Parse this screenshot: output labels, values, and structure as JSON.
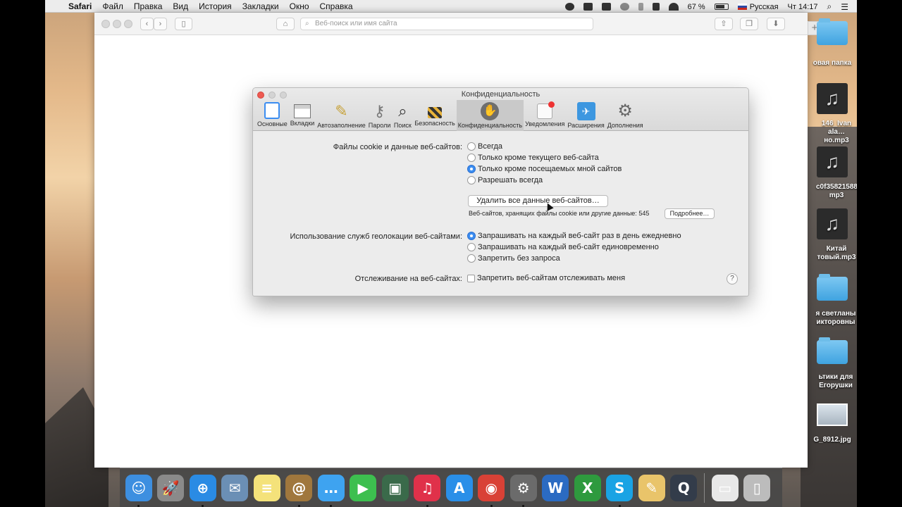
{
  "menubar": {
    "apple": "",
    "app": "Safari",
    "items": [
      "Файл",
      "Правка",
      "Вид",
      "История",
      "Закладки",
      "Окно",
      "Справка"
    ],
    "battery": "67 %",
    "input_source": "Русская",
    "clock": "Чт 14:17"
  },
  "safari": {
    "url_placeholder": "Веб-поиск или имя сайта",
    "new_tab": "+"
  },
  "prefs": {
    "title": "Конфиденциальность",
    "tabs": [
      {
        "label": "Основные",
        "icon": "switch-icon"
      },
      {
        "label": "Вкладки",
        "icon": "tabs-icon"
      },
      {
        "label": "Автозаполнение",
        "icon": "pencil-icon"
      },
      {
        "label": "Пароли",
        "icon": "key-icon"
      },
      {
        "label": "Поиск",
        "icon": "magnifier-icon"
      },
      {
        "label": "Безопасность",
        "icon": "lock-icon"
      },
      {
        "label": "Конфиденциальность",
        "icon": "hand-icon",
        "active": true
      },
      {
        "label": "Уведомления",
        "icon": "notification-icon"
      },
      {
        "label": "Расширения",
        "icon": "puzzle-icon"
      },
      {
        "label": "Дополнения",
        "icon": "gear-icon"
      }
    ],
    "cookies": {
      "label": "Файлы cookie и данные веб-сайтов:",
      "options": [
        "Всегда",
        "Только кроме текущего веб-сайта",
        "Только кроме посещаемых мной сайтов",
        "Разрешать всегда"
      ],
      "selected": 2,
      "remove_button": "Удалить все данные веб-сайтов…",
      "info": "Веб-сайтов, хранящих файлы cookie или другие данные: 545",
      "details_button": "Подробнее…"
    },
    "location": {
      "label": "Использование служб геолокации веб-сайтами:",
      "options": [
        "Запрашивать на каждый веб-сайт раз в день ежедневно",
        "Запрашивать на каждый веб-сайт единовременно",
        "Запретить без запроса"
      ],
      "selected": 0
    },
    "tracking": {
      "label": "Отслеживание на веб-сайтах:",
      "checkbox": "Запретить веб-сайтам отслеживать меня",
      "checked": false
    },
    "help": "?"
  },
  "desktop": {
    "items": [
      {
        "label": "овая папка",
        "kind": "folder"
      },
      {
        "label": "146_Ivan ala…но.mp3",
        "kind": "mp3"
      },
      {
        "label": "c0f35821588. mp3",
        "kind": "mp3"
      },
      {
        "label": "Китай товый.mp3",
        "kind": "mp3"
      },
      {
        "label": "я светланы икторовны",
        "kind": "folder"
      },
      {
        "label": "ьтики для Егорушки",
        "kind": "folder"
      },
      {
        "label": "G_8912.jpg",
        "kind": "image"
      }
    ]
  },
  "dock": {
    "apps": [
      {
        "name": "finder-icon",
        "glyph": "☺",
        "color": "#3d8fe0"
      },
      {
        "name": "launchpad-icon",
        "glyph": "🚀",
        "color": "#8a8a8a"
      },
      {
        "name": "safari-icon",
        "glyph": "⊕",
        "color": "#2a8be4"
      },
      {
        "name": "mail-icon",
        "glyph": "✉",
        "color": "#6b8fb5"
      },
      {
        "name": "notes-icon",
        "glyph": "≡",
        "color": "#f4e27a"
      },
      {
        "name": "contacts-icon",
        "glyph": "@",
        "color": "#a0773d"
      },
      {
        "name": "messages-icon",
        "glyph": "…",
        "color": "#3ea3f0"
      },
      {
        "name": "facetime-icon",
        "glyph": "▶",
        "color": "#3dbf4f"
      },
      {
        "name": "photo-booth-icon",
        "glyph": "▣",
        "color": "#3a6a4a"
      },
      {
        "name": "itunes-icon",
        "glyph": "♫",
        "color": "#e0314a"
      },
      {
        "name": "app-store-icon",
        "glyph": "A",
        "color": "#2a8fe8"
      },
      {
        "name": "chrome-icon",
        "glyph": "◉",
        "color": "#d94136"
      },
      {
        "name": "system-preferences-icon",
        "glyph": "⚙",
        "color": "#6b6b6b"
      },
      {
        "name": "word-icon",
        "glyph": "W",
        "color": "#2b6bc2"
      },
      {
        "name": "excel-icon",
        "glyph": "X",
        "color": "#2e9a3e"
      },
      {
        "name": "skype-icon",
        "glyph": "S",
        "color": "#1aa3e4"
      },
      {
        "name": "preview-icon",
        "glyph": "✎",
        "color": "#e9c46a"
      },
      {
        "name": "quicktime-icon",
        "glyph": "Q",
        "color": "#333c4a"
      }
    ],
    "right": [
      {
        "name": "downloads-stack-icon",
        "glyph": "▭",
        "color": "#e8e8e8"
      },
      {
        "name": "trash-icon",
        "glyph": "▯",
        "color": "#bcbcbc"
      }
    ]
  }
}
